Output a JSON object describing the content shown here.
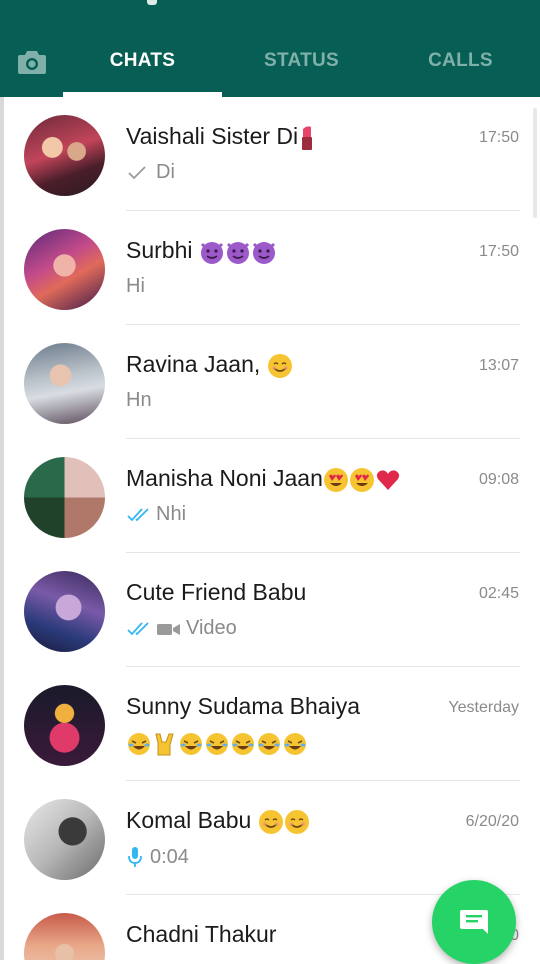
{
  "header": {
    "tabs": [
      {
        "label": "CHATS",
        "active": true
      },
      {
        "label": "STATUS",
        "active": false
      },
      {
        "label": "CALLS",
        "active": false
      }
    ],
    "colors": {
      "bar": "#075e54",
      "active": "#ffffff",
      "inactive": "#7fb1aa"
    }
  },
  "chats": [
    {
      "name": "Vaishali Sister  Di",
      "name_emoji": [
        "lipstick-emoji"
      ],
      "time": "17:50",
      "preview": "Di",
      "status": "sent-single-check"
    },
    {
      "name": "Surbhi ",
      "name_emoji": [
        "smiling-devil-emoji",
        "smiling-devil-emoji",
        "smiling-devil-emoji"
      ],
      "time": "17:50",
      "preview": "Hi",
      "status": "none"
    },
    {
      "name": "Ravina Jaan, ",
      "name_emoji": [
        "smiling-face-emoji"
      ],
      "time": "13:07",
      "preview": "Hn",
      "status": "none"
    },
    {
      "name": "Manisha Noni Jaan",
      "name_emoji": [
        "heart-eyes-emoji",
        "heart-eyes-emoji",
        "red-heart-emoji"
      ],
      "time": "09:08",
      "preview": "Nhi",
      "status": "read-double-check"
    },
    {
      "name": "Cute Friend Babu",
      "name_emoji": [],
      "time": "02:45",
      "preview": "Video",
      "status": "read-double-check",
      "media": "video-camera-icon"
    },
    {
      "name": "Sunny Sudama Bhaiya",
      "name_emoji": [],
      "time": "Yesterday",
      "preview_emoji": [
        "laughing-emoji",
        "rock-hand-emoji",
        "laughing-emoji",
        "laughing-emoji",
        "laughing-emoji",
        "laughing-emoji",
        "laughing-emoji"
      ],
      "status": "none"
    },
    {
      "name": "Komal Babu ",
      "name_emoji": [
        "smiling-face-emoji",
        "smiling-face-emoji"
      ],
      "time": "6/20/20",
      "preview": "0:04",
      "status": "voice-note",
      "media": "microphone-icon"
    },
    {
      "name": "Chadni Thakur",
      "name_emoji": [],
      "time": "0",
      "preview": "",
      "status": "none"
    }
  ],
  "colors": {
    "fab": "#25d366",
    "read_tick": "#34b7f1",
    "muted_text": "#8a8a8a"
  }
}
